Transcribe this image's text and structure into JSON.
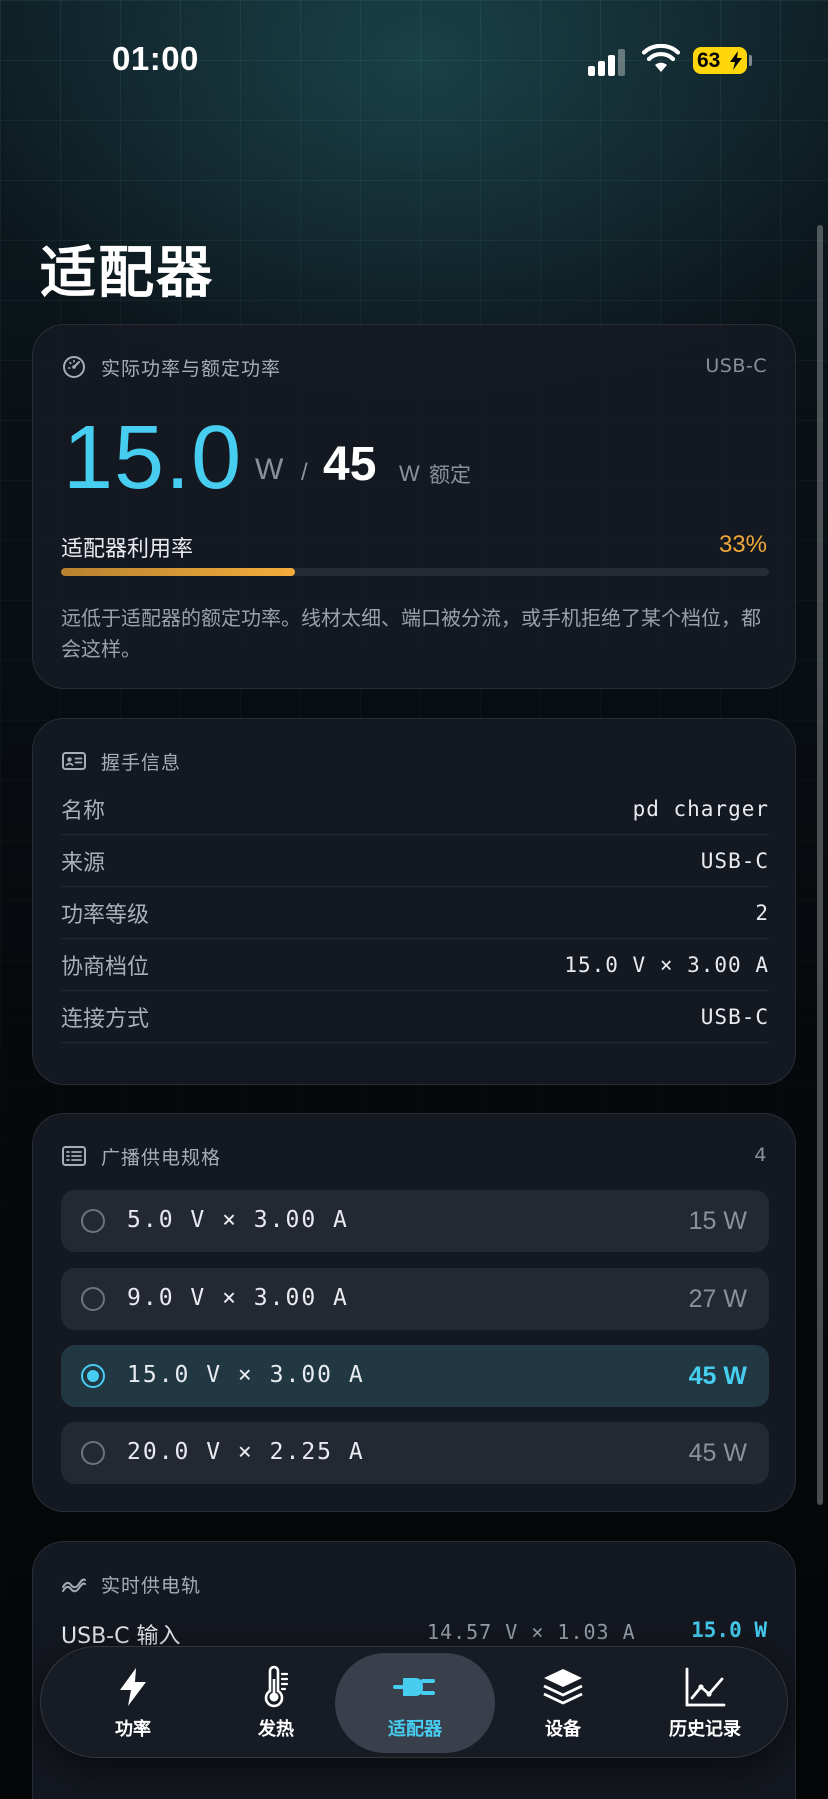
{
  "status_bar": {
    "time": "01:00",
    "battery_level": "63"
  },
  "page": {
    "title": "适配器"
  },
  "power_card": {
    "title": "实际功率与额定功率",
    "source_tag": "USB-C",
    "actual_power": "15.0",
    "unit": "W",
    "separator": "/",
    "rated_power": "45",
    "rated_suffix": "额定",
    "utilization_label": "适配器利用率",
    "utilization_percent_text": "33%",
    "utilization_fraction": 0.33,
    "description": "远低于适配器的额定功率。线材太细、端口被分流，或手机拒绝了某个档位，都会这样。"
  },
  "handshake_card": {
    "title": "握手信息",
    "rows": [
      {
        "key": "名称",
        "value": "pd charger"
      },
      {
        "key": "来源",
        "value": "USB-C"
      },
      {
        "key": "功率等级",
        "value": "2"
      },
      {
        "key": "协商档位",
        "value": "15.0 V × 3.00 A"
      },
      {
        "key": "连接方式",
        "value": "USB-C"
      }
    ]
  },
  "profiles_card": {
    "title": "广播供电规格",
    "count": "4",
    "profiles": [
      {
        "desc": "5.0 V × 3.00 A",
        "watts": "15 W",
        "selected": false
      },
      {
        "desc": "9.0 V × 3.00 A",
        "watts": "27 W",
        "selected": false
      },
      {
        "desc": "15.0 V × 3.00 A",
        "watts": "45 W",
        "selected": true
      },
      {
        "desc": "20.0 V × 2.25 A",
        "watts": "45 W",
        "selected": false
      }
    ]
  },
  "rail_card": {
    "title": "实时供电轨",
    "row_label": "USB-C 输入",
    "row_values": "14.57 V × 1.03 A",
    "row_power": "15.0 W"
  },
  "tab_bar": {
    "active": "适配器",
    "tabs": [
      {
        "label": "功率",
        "icon": "bolt-icon"
      },
      {
        "label": "发热",
        "icon": "thermometer-icon"
      },
      {
        "label": "适配器",
        "icon": "plug-icon"
      },
      {
        "label": "设备",
        "icon": "layers-icon"
      },
      {
        "label": "历史记录",
        "icon": "chart-line-icon"
      }
    ]
  },
  "colors": {
    "accent": "#46cdf0",
    "warning": "#f4ad3c",
    "card": "#161a22",
    "battery": "#ffd60a"
  }
}
